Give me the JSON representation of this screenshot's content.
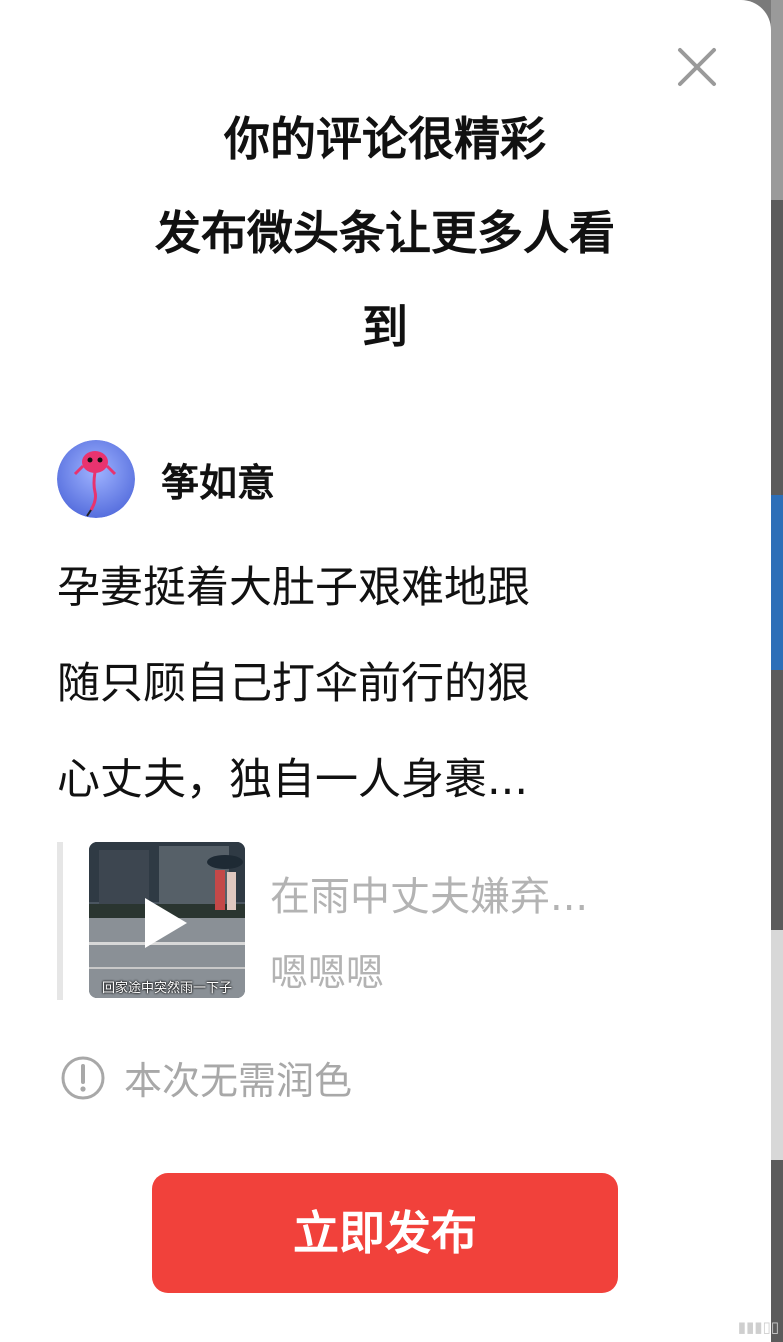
{
  "dialog": {
    "title_lines": [
      "你的评论很精彩",
      "发布微头条让更多人看",
      "到"
    ],
    "close_icon": "close-icon"
  },
  "author": {
    "name": "筝如意",
    "avatar_icon": "kite-avatar"
  },
  "comment": {
    "lines": [
      "孕妻挺着大肚子艰难地跟",
      "随只顾自己打伞前行的狠",
      "心丈夫，独自一人身裹..."
    ]
  },
  "quoted_video": {
    "title": "在雨中丈夫嫌弃...",
    "author": "嗯嗯嗯",
    "thumb_caption": "回家途中突然雨一下子",
    "play_icon": "play-icon"
  },
  "notice": {
    "icon": "info-icon",
    "text": "本次无需润色"
  },
  "actions": {
    "publish_label": "立即发布"
  },
  "colors": {
    "accent": "#f1413b",
    "muted_text": "#b3b3b3"
  }
}
